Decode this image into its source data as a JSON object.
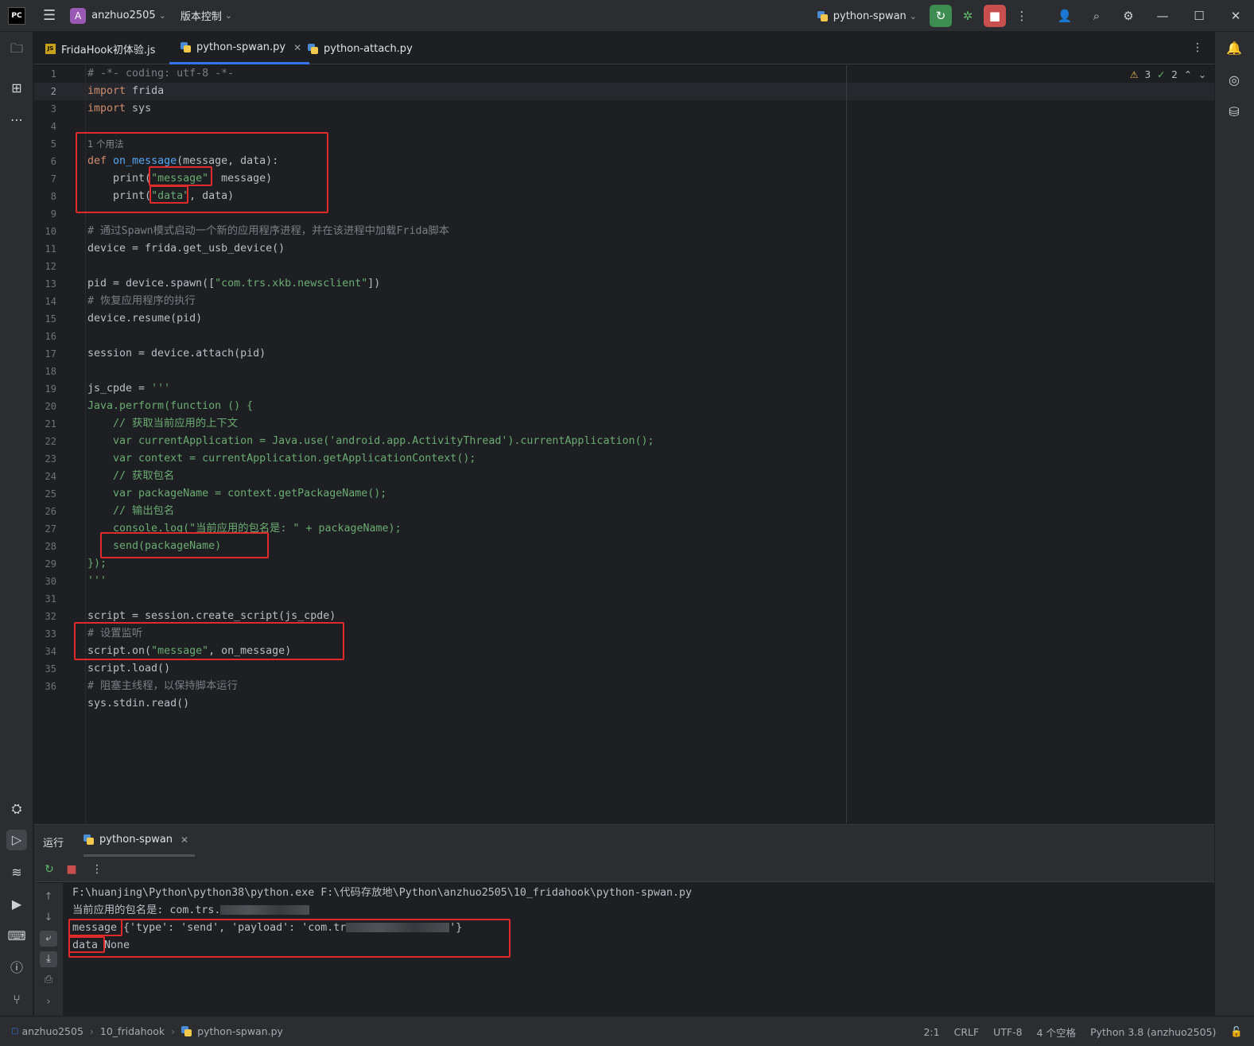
{
  "titlebar": {
    "logo_text": "PC",
    "project_badge": "A",
    "project_name": "anzhuo2505",
    "vcs_label": "版本控制",
    "run_config": "python-spwan"
  },
  "tabs": [
    {
      "label": "FridaHook初体验.js",
      "type": "js"
    },
    {
      "label": "python-spwan.py",
      "type": "py",
      "active": true
    },
    {
      "label": "python-attach.py",
      "type": "py"
    }
  ],
  "inspections": {
    "warnings": "3",
    "ok": "2"
  },
  "editor": {
    "line_numbers": [
      "1",
      "2",
      "3",
      "4",
      "5",
      "6",
      "7",
      "8",
      "9",
      "10",
      "11",
      "12",
      "13",
      "14",
      "15",
      "16",
      "17",
      "18",
      "19",
      "20",
      "21",
      "22",
      "23",
      "24",
      "25",
      "26",
      "27",
      "28",
      "29",
      "30",
      "31",
      "32",
      "33",
      "34",
      "35",
      "36"
    ],
    "usage_hint": "1 个用法",
    "lines": {
      "l1": "# -*- coding: utf-8 -*-",
      "l2_kw": "import",
      "l2_rest": " frida",
      "l3_kw": "import",
      "l3_rest": " sys",
      "l5_kw": "def",
      "l5_fn": "on_message",
      "l5_rest": "(message, data):",
      "l6_a": "    print(",
      "l6_str": "\"message\"",
      "l6_b": ", message)",
      "l7_a": "    print(",
      "l7_str": "\"data\"",
      "l7_b": ", data)",
      "l9": "# 通过Spawn模式启动一个新的应用程序进程，并在该进程中加载Frida脚本",
      "l10": "device = frida.get_usb_device()",
      "l12_a": "pid = device.spawn([",
      "l12_str": "\"com.trs.xkb.newsclient\"",
      "l12_b": "])",
      "l13": "# 恢复应用程序的执行",
      "l14": "device.resume(pid)",
      "l16": "session = device.attach(pid)",
      "l18_a": "js_cpde = ",
      "l18_str": "'''",
      "l19": "Java.perform(function () {",
      "l20": "    // 获取当前应用的上下文",
      "l21": "    var currentApplication = Java.use('android.app.ActivityThread').currentApplication();",
      "l22": "    var context = currentApplication.getApplicationContext();",
      "l23": "    // 获取包名",
      "l24": "    var packageName = context.getPackageName();",
      "l25": "    // 输出包名",
      "l26": "    console.log(\"当前应用的包名是: \" + packageName);",
      "l27": "    send(packageName)",
      "l28": "});",
      "l29": "'''",
      "l31": "script = session.create_script(js_cpde)",
      "l32": "# 设置监听",
      "l33_a": "script.on(",
      "l33_str": "\"message\"",
      "l33_b": ", on_message)",
      "l34": "script.load()",
      "l35": "# 阻塞主线程，以保持脚本运行",
      "l36": "sys.stdin.read()"
    }
  },
  "run_panel": {
    "title": "运行",
    "tab_label": "python-spwan",
    "console": {
      "line1": "F:\\huanjing\\Python\\python38\\python.exe F:\\代码存放地\\Python\\anzhuo2505\\10_fridahook\\python-spwan.py",
      "line2": "当前应用的包名是: com.trs.",
      "line3_a": "message ",
      "line3_b": "{'type': 'send', 'payload': 'com.tr",
      "line3_c": "'}",
      "line4_a": "data ",
      "line4_b": "None"
    }
  },
  "statusbar": {
    "crumbs": [
      "anzhuo2505",
      "10_fridahook",
      "python-spwan.py"
    ],
    "position": "2:1",
    "line_sep": "CRLF",
    "encoding": "UTF-8",
    "indent": "4 个空格",
    "interpreter": "Python 3.8 (anzhuo2505)"
  },
  "colors": {
    "annotation": "#e02b2b",
    "accent": "#3574f0",
    "keyword": "#cf8e6d",
    "string": "#6aab73",
    "function": "#56a8f5"
  }
}
